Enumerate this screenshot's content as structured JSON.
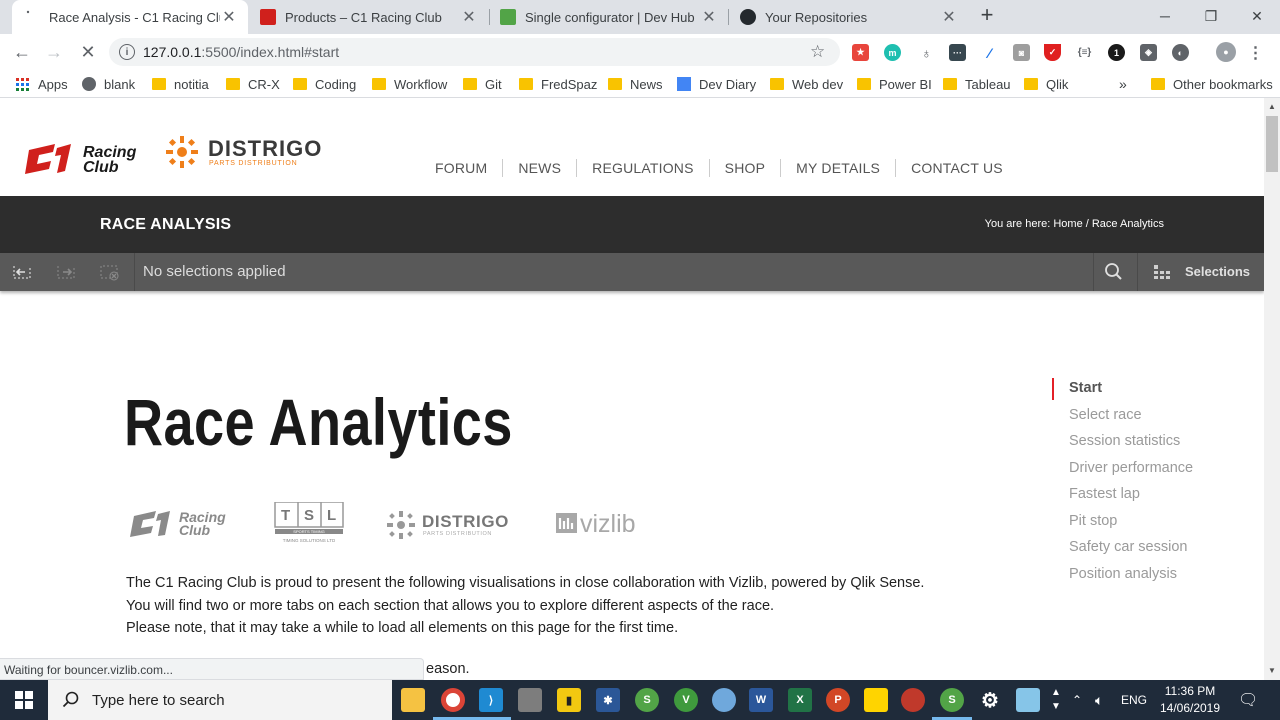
{
  "browser": {
    "tabs": [
      {
        "title": "Race Analysis - C1 Racing Club",
        "active": true
      },
      {
        "title": "Products – C1 Racing Club",
        "active": false
      },
      {
        "title": "Single configurator | Dev Hub",
        "active": false
      },
      {
        "title": "Your Repositories",
        "active": false
      }
    ],
    "url_host": "127.0.0.1",
    "url_rest": ":5500/index.html#start",
    "bookmarks": [
      "Apps",
      "blank",
      "notitia",
      "CR-X",
      "Coding",
      "Workflow",
      "Git",
      "FredSpaz",
      "News",
      "Dev Diary",
      "Web dev",
      "Power BI",
      "Tableau",
      "Qlik"
    ],
    "overflow": "»",
    "other_bookmarks": "Other bookmarks",
    "status_text": "Waiting for bouncer.vizlib.com..."
  },
  "site": {
    "logo_c1_line1": "Racing",
    "logo_c1_line2": "Club",
    "logo_distrigo": "DISTRIGO",
    "logo_distrigo_sub": "PARTS DISTRIBUTION",
    "nav": [
      "FORUM",
      "NEWS",
      "REGULATIONS",
      "SHOP",
      "MY DETAILS",
      "CONTACT US"
    ],
    "title_bar": "RACE ANALYSIS",
    "breadcrumb": "You are here: Home / Race Analytics"
  },
  "selection_bar": {
    "message": "No selections applied",
    "selections_label": "Selections"
  },
  "content": {
    "heading": "Race Analytics",
    "partner_logos": {
      "c1_line1": "Racing",
      "c1_line2": "Club",
      "tsl_letters": [
        "T",
        "S",
        "L"
      ],
      "tsl_line1": "SPORTS TIMING",
      "tsl_line2": "TIMING SOLUTIONS LTD",
      "distrigo": "DISTRIGO",
      "distrigo_sub": "PARTS DISTRIBUTION",
      "vizlib": "vizlib"
    },
    "intro_lines": [
      "The C1 Racing Club is proud to present the following visualisations in close collaboration with Vizlib, powered by Qlik Sense.",
      "You will find two or more tabs on each section that allows you to explore different aspects of the race.",
      "Please note, that it may take a while to load all elements on this page for the first time."
    ],
    "partial_line": "eason."
  },
  "side_nav": {
    "items": [
      "Start",
      "Select race",
      "Session statistics",
      "Driver performance",
      "Fastest lap",
      "Pit stop",
      "Safety car session",
      "Position analysis"
    ],
    "active_index": 0,
    "accent_color": "#e32027"
  },
  "taskbar": {
    "search_placeholder": "Type here to search",
    "language": "ENG",
    "time": "11:36 PM",
    "date": "14/06/2019"
  }
}
